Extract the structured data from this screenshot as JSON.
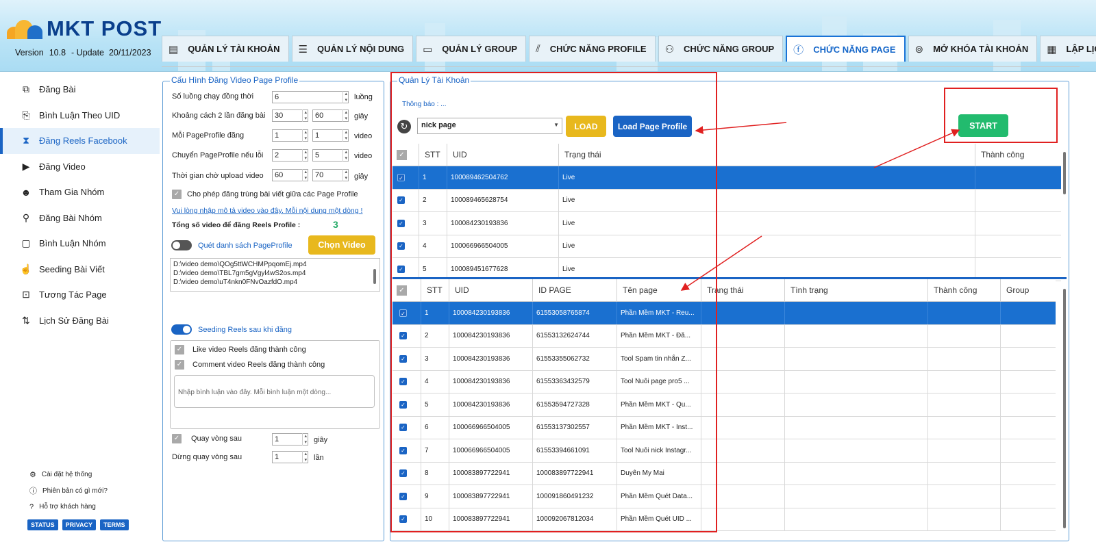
{
  "header": {
    "logo_text": "MKT POST",
    "version_label": "Version",
    "version_number": "10.8",
    "update_label": "- Update",
    "update_date": "20/11/2023"
  },
  "tabs": [
    {
      "label": "QUẢN LÝ TÀI KHOẢN",
      "icon": "id-card-icon"
    },
    {
      "label": "QUẢN LÝ NỘI DUNG",
      "icon": "list-icon"
    },
    {
      "label": "QUẢN LÝ GROUP",
      "icon": "document-icon"
    },
    {
      "label": "CHỨC NĂNG PROFILE",
      "icon": "slash-icon"
    },
    {
      "label": "CHỨC NĂNG GROUP",
      "icon": "users-icon"
    },
    {
      "label": "CHỨC NĂNG PAGE",
      "icon": "facebook-icon"
    },
    {
      "label": "MỞ KHÓA TÀI KHOẢN",
      "icon": "fingerprint-icon"
    },
    {
      "label": "LẬP LỊCH",
      "icon": "calendar-icon"
    }
  ],
  "sidebar": {
    "items": [
      {
        "label": "Đăng Bài",
        "icon": "post-icon"
      },
      {
        "label": "Bình Luận Theo UID",
        "icon": "comment-uid-icon"
      },
      {
        "label": "Đăng Reels Facebook",
        "icon": "hourglass-icon"
      },
      {
        "label": "Đăng Video",
        "icon": "video-icon"
      },
      {
        "label": "Tham Gia Nhóm",
        "icon": "join-group-icon"
      },
      {
        "label": "Đăng Bài Nhóm",
        "icon": "group-post-icon"
      },
      {
        "label": "Bình Luận Nhóm",
        "icon": "group-comment-icon"
      },
      {
        "label": "Seeding Bài Viết",
        "icon": "hand-icon"
      },
      {
        "label": "Tương Tác Page",
        "icon": "interact-icon"
      },
      {
        "label": "Lịch Sử Đăng Bài",
        "icon": "sort-icon"
      }
    ],
    "bottom_links": [
      {
        "label": "Cài đặt hệ thống",
        "icon": "gear-icon"
      },
      {
        "label": "Phiên bản có gì mới?",
        "icon": "info-icon"
      },
      {
        "label": "Hỗ trợ khách hàng",
        "icon": "help-icon"
      }
    ],
    "badges": [
      "STATUS",
      "PRIVACY",
      "TERMS"
    ]
  },
  "config": {
    "title": "Cấu Hình Đăng Video Page Profile",
    "threads_label": "Số luồng chạy đồng thời",
    "threads_value": "6",
    "threads_unit": "luồng",
    "interval_label": "Khoảng cách 2 lần đăng bài",
    "interval_min": "30",
    "interval_max": "60",
    "interval_unit": "giây",
    "per_profile_label": "Mỗi PageProfile đăng",
    "per_profile_min": "1",
    "per_profile_max": "1",
    "per_profile_unit": "video",
    "switch_err_label": "Chuyển PageProfile nếu lỗi",
    "switch_err_min": "2",
    "switch_err_max": "5",
    "switch_err_unit": "video",
    "upload_wait_label": "Thời gian chờ upload video",
    "upload_wait_min": "60",
    "upload_wait_max": "70",
    "upload_wait_unit": "giây",
    "allow_dup_label": "Cho phép đăng trùng bài viết giữa các Page Profile",
    "desc_link": "Vui lòng nhập mô tả video vào đây. Mỗi nội dung một dòng !",
    "total_label": "Tổng số video để đăng Reels Profile :",
    "total_value": "3",
    "scan_label": "Quét danh sách PageProfile",
    "choose_video_button": "Chọn Video",
    "files": [
      "D:\\video demo\\QOg5ttWCHMPpqomEj.mp4",
      "D:\\video demo\\TBL7gm5gVgyl4wS2os.mp4",
      "D:\\video demo\\uT4nkn0FNvOazfdO.mp4"
    ],
    "seeding_label": "Seeding Reels sau khi đăng",
    "like_label": "Like video Reels đăng thành công",
    "comment_label": "Comment video Reels đăng thành công",
    "comment_placeholder": "Nhập bình luận vào đây. Mỗi bình luận một dòng...",
    "loop_label": "Quay vòng sau",
    "loop_value": "1",
    "loop_unit": "giây",
    "stop_loop_label": "Dừng quay vòng sau",
    "stop_loop_value": "1",
    "stop_loop_unit": "lần"
  },
  "manager": {
    "title": "Quản Lý Tài Khoản",
    "notice": "Thông báo : ...",
    "account_select": "nick page",
    "load_button": "LOAD",
    "load_page_button": "Load Page Profile",
    "start_button": "START",
    "accounts_columns": [
      "STT",
      "UID",
      "Trạng thái",
      "Thành công"
    ],
    "accounts": [
      {
        "stt": "1",
        "uid": "100089462504762",
        "status": "Live"
      },
      {
        "stt": "2",
        "uid": "100089465628754",
        "status": "Live"
      },
      {
        "stt": "3",
        "uid": "100084230193836",
        "status": "Live"
      },
      {
        "stt": "4",
        "uid": "100066966504005",
        "status": "Live"
      },
      {
        "stt": "5",
        "uid": "100089451677628",
        "status": "Live"
      }
    ],
    "pages_columns": [
      "STT",
      "UID",
      "ID PAGE",
      "Tên page",
      "Trạng thái",
      "Tình trạng",
      "Thành công",
      "Group"
    ],
    "pages": [
      {
        "stt": "1",
        "uid": "100084230193836",
        "id_page": "61553058765874",
        "name": "Phần Mềm MKT - Reu..."
      },
      {
        "stt": "2",
        "uid": "100084230193836",
        "id_page": "61553132624744",
        "name": "Phần Mềm MKT - Đă..."
      },
      {
        "stt": "3",
        "uid": "100084230193836",
        "id_page": "61553355062732",
        "name": "Tool Spam tin nhắn Z..."
      },
      {
        "stt": "4",
        "uid": "100084230193836",
        "id_page": "61553363432579",
        "name": "Tool Nuôi page pro5 ..."
      },
      {
        "stt": "5",
        "uid": "100084230193836",
        "id_page": "61553594727328",
        "name": "Phần Mềm MKT - Qu..."
      },
      {
        "stt": "6",
        "uid": "100066966504005",
        "id_page": "61553137302557",
        "name": "Phần Mềm MKT - Inst..."
      },
      {
        "stt": "7",
        "uid": "100066966504005",
        "id_page": "61553394661091",
        "name": "Tool Nuôi nick Instagr..."
      },
      {
        "stt": "8",
        "uid": "100083897722941",
        "id_page": "100083897722941",
        "name": "Duyên My Mai"
      },
      {
        "stt": "9",
        "uid": "100083897722941",
        "id_page": "100091860491232",
        "name": "Phần Mềm Quét Data..."
      },
      {
        "stt": "10",
        "uid": "100083897722941",
        "id_page": "100092067812034",
        "name": "Phần Mềm Quét UID ..."
      }
    ]
  },
  "colors": {
    "accent": "#1a64c4",
    "selected_row": "#1a70d0",
    "load_button": "#e8b81d",
    "start_button": "#22bb6e",
    "annotation": "#e02020"
  }
}
